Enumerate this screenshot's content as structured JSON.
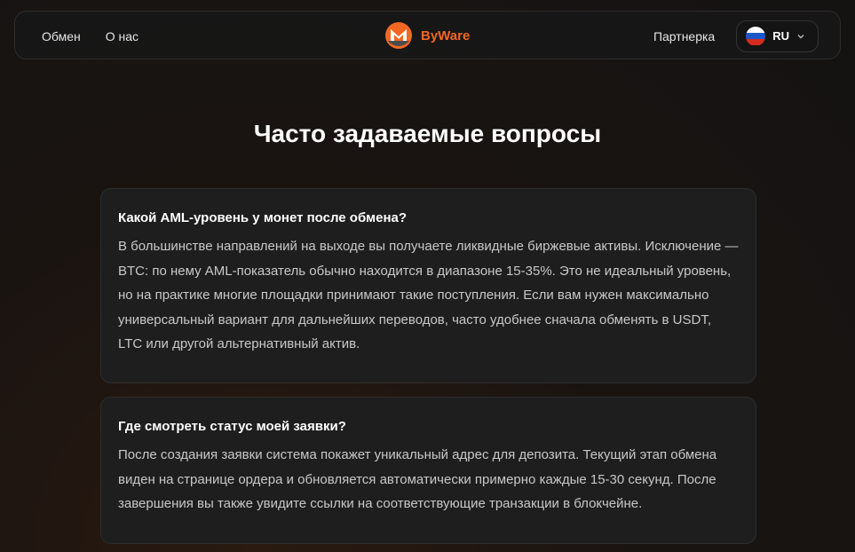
{
  "nav": {
    "links": [
      "Обмен",
      "О нас"
    ],
    "brand": "ByWare",
    "partner": "Партнерка",
    "language": "RU"
  },
  "page_title": "Часто задаваемые вопросы",
  "faq": [
    {
      "question": "Какой AML-уровень у монет после обмена?",
      "answer": "В большинстве направлений на выходе вы получаете ликвидные биржевые активы. Исключение — BTC: по нему AML-показатель обычно находится в диапазоне 15-35%. Это не идеальный уровень, но на практике многие площадки принимают такие поступления. Если вам нужен максимально универсальный вариант для дальнейших переводов, часто удобнее сначала обменять в USDT, LTC или другой альтернативный актив."
    },
    {
      "question": "Где смотреть статус моей заявки?",
      "answer": "После создания заявки система покажет уникальный адрес для депозита. Текущий этап обмена виден на странице ордера и обновляется автоматически примерно каждые 15-30 секунд. После завершения вы также увидите ссылки на соответствующие транзакции в блокчейне."
    }
  ],
  "colors": {
    "brand": "#f26822",
    "card": "#1e1e1e",
    "text_muted": "#c8c8c8"
  },
  "icons": {
    "logo": "monero-logo-icon",
    "chevron": "chevron-down-icon",
    "flag": "russia-flag-icon"
  }
}
